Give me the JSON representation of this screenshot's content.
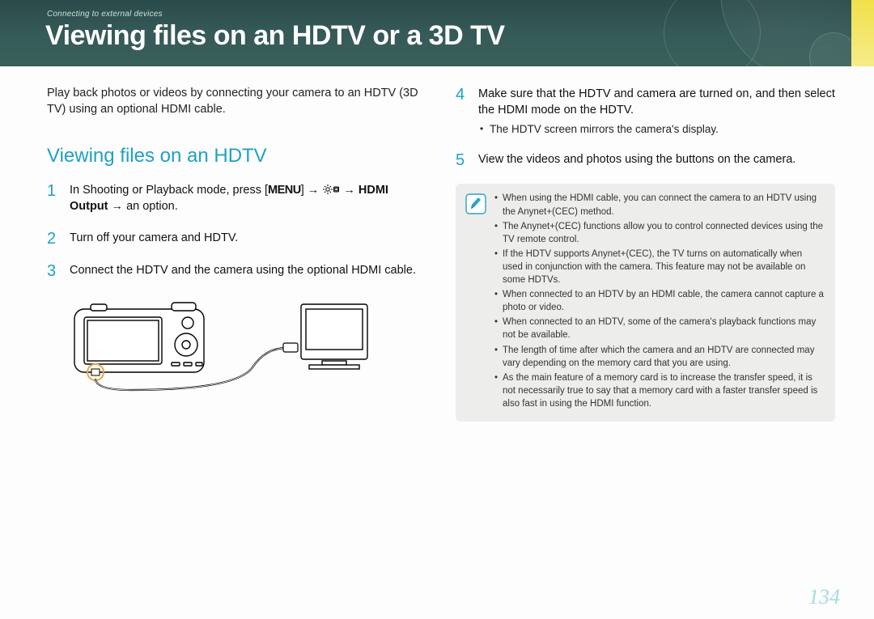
{
  "header": {
    "breadcrumb": "Connecting to external devices",
    "title": "Viewing files on an HDTV or a 3D TV"
  },
  "left": {
    "intro": "Play back photos or videos by connecting your camera to an HDTV (3D TV) using an optional HDMI cable.",
    "section_title": "Viewing files on an HDTV",
    "steps": {
      "s1_num": "1",
      "s1_pre": "In Shooting or Playback mode, press [",
      "s1_menu": "MENU",
      "s1_mid": "] → ",
      "s1_after_icon": " → ",
      "s1_bold": "HDMI Output",
      "s1_end": " → an option.",
      "s2_num": "2",
      "s2_text": "Turn off your camera and HDTV.",
      "s3_num": "3",
      "s3_text": "Connect the HDTV and the camera using the optional HDMI cable."
    }
  },
  "right": {
    "steps": {
      "s4_num": "4",
      "s4_text": "Make sure that the HDTV and camera are turned on, and then select the HDMI mode on the HDTV.",
      "s4_sub": "The HDTV screen mirrors the camera's display.",
      "s5_num": "5",
      "s5_text": "View the videos and photos using the buttons on the camera."
    },
    "notes": [
      "When using the HDMI cable, you can connect the camera to an HDTV using the Anynet+(CEC) method.",
      "The Anynet+(CEC) functions allow you to control connected devices using the TV remote control.",
      "If the HDTV supports Anynet+(CEC), the TV turns on automatically when used in conjunction with the camera. This feature may not be available on some HDTVs.",
      "When connected to an HDTV by an HDMI cable, the camera cannot capture a photo or video.",
      "When connected to an HDTV, some of the camera's playback functions may not be available.",
      "The length of time after which the camera and an HDTV are connected may vary depending on the memory card that you are using.",
      "As the main feature of a memory card is to increase the transfer speed, it is not necessarily true to say that a memory card with a faster transfer speed is also fast in using the HDMI function."
    ]
  },
  "page_number": "134"
}
